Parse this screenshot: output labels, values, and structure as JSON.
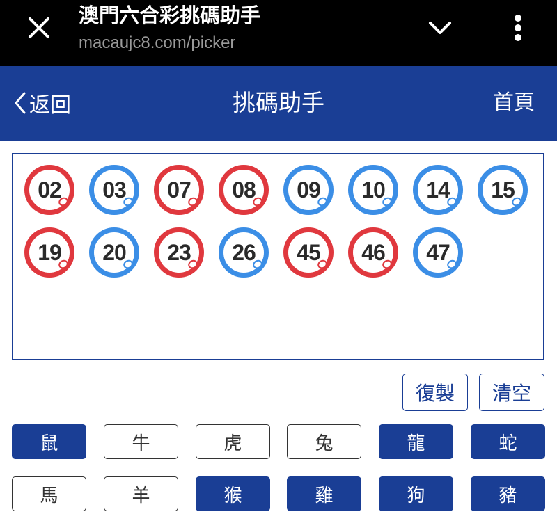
{
  "browser": {
    "title": "澳門六合彩挑碼助手",
    "url": "macaujc8.com/picker",
    "icons": {
      "close": "close-icon",
      "collapse": "chevron-down-icon",
      "menu": "more-vert-icon"
    }
  },
  "header": {
    "back_label": "返回",
    "title": "挑碼助手",
    "home_label": "首頁"
  },
  "picked_numbers": [
    {
      "value": "02",
      "color": "red"
    },
    {
      "value": "03",
      "color": "blue"
    },
    {
      "value": "07",
      "color": "red"
    },
    {
      "value": "08",
      "color": "red"
    },
    {
      "value": "09",
      "color": "blue"
    },
    {
      "value": "10",
      "color": "blue"
    },
    {
      "value": "14",
      "color": "blue"
    },
    {
      "value": "15",
      "color": "blue"
    },
    {
      "value": "19",
      "color": "red"
    },
    {
      "value": "20",
      "color": "blue"
    },
    {
      "value": "23",
      "color": "red"
    },
    {
      "value": "26",
      "color": "blue"
    },
    {
      "value": "45",
      "color": "red"
    },
    {
      "value": "46",
      "color": "red"
    },
    {
      "value": "47",
      "color": "blue"
    }
  ],
  "actions": {
    "copy_label": "復製",
    "clear_label": "清空"
  },
  "zodiac": [
    {
      "label": "鼠",
      "selected": true
    },
    {
      "label": "牛",
      "selected": false
    },
    {
      "label": "虎",
      "selected": false
    },
    {
      "label": "兔",
      "selected": false
    },
    {
      "label": "龍",
      "selected": true
    },
    {
      "label": "蛇",
      "selected": true
    },
    {
      "label": "馬",
      "selected": false
    },
    {
      "label": "羊",
      "selected": false
    },
    {
      "label": "猴",
      "selected": true
    },
    {
      "label": "雞",
      "selected": true
    },
    {
      "label": "狗",
      "selected": true
    },
    {
      "label": "豬",
      "selected": true
    }
  ],
  "colors": {
    "brand_blue": "#1a3e95",
    "ball_red": "#e0383e",
    "ball_blue": "#3b8ee6",
    "chrome_bg": "#000000"
  }
}
